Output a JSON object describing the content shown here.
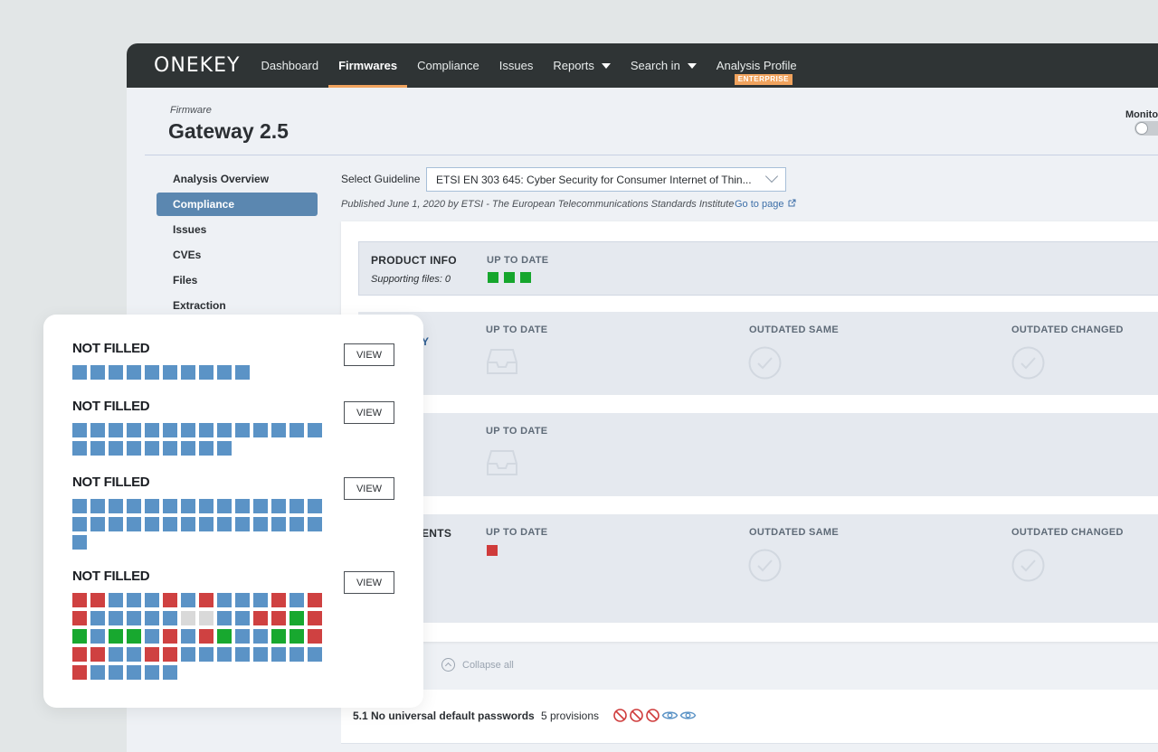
{
  "nav": {
    "logo": "ONEKEY",
    "items": [
      {
        "label": "Dashboard"
      },
      {
        "label": "Firmwares"
      },
      {
        "label": "Compliance"
      },
      {
        "label": "Issues"
      },
      {
        "label": "Reports"
      },
      {
        "label": "Search in"
      },
      {
        "label": "Analysis Profile"
      }
    ],
    "badge": "ENTERPRISE"
  },
  "header": {
    "label": "Firmware",
    "title": "Gateway 2.5",
    "monitor_label": "Monitor"
  },
  "sidebar": {
    "items": [
      {
        "label": "Analysis Overview"
      },
      {
        "label": "Compliance"
      },
      {
        "label": "Issues"
      },
      {
        "label": "CVEs"
      },
      {
        "label": "Files"
      },
      {
        "label": "Extraction"
      }
    ]
  },
  "guideline": {
    "label": "Select Guideline",
    "selected": "ETSI EN 303 645: Cyber Security for Consumer Internet of Thin...",
    "published": "Published June 1, 2020 by ETSI - The European Telecommunications Standards Institute",
    "goto_label": "Go to page"
  },
  "rows": {
    "product": {
      "title": "PRODUCT INFO",
      "sub": "Supporting files: 0",
      "col1": "UP TO DATE"
    },
    "row2": {
      "title_fragment": "Y",
      "col1": "UP TO DATE",
      "col2": "OUTDATED SAME",
      "col3": "OUTDATED CHANGED"
    },
    "row3": {
      "col1": "UP TO DATE"
    },
    "row4": {
      "title_fragment": "ENTS",
      "col1": "UP TO DATE",
      "col2": "OUTDATED SAME",
      "col3": "OUTDATED CHANGED"
    }
  },
  "collapse_label": "Collapse all",
  "section": {
    "title": "5.1 No universal default passwords",
    "provisions": "5 provisions",
    "icons": [
      "blocked-icon",
      "blocked-icon",
      "blocked-icon",
      "eye-icon",
      "eye-icon"
    ]
  },
  "card": {
    "groups": [
      {
        "status": "NOT FILLED",
        "button": "VIEW",
        "cells": "bbbbbbbbbb"
      },
      {
        "status": "NOT FILLED",
        "button": "VIEW",
        "cells": "bbbbbbbbbbbbbbbbbbbbbbb"
      },
      {
        "status": "NOT FILLED",
        "button": "VIEW",
        "cells": "bbbbbbbbbbbbbbbbbbbbbbbbbbbbb"
      },
      {
        "status": "NOT FILLED",
        "button": "VIEW",
        "cells": "rrbbbrbrbbbrbrrbbbbbxxbbrrgrgbggbrbrgbbggrrrbbrrbbbbbbbbrbbbbb"
      }
    ]
  },
  "colors": {
    "nav_bg": "#2f3435",
    "accent": "#f0a35e",
    "sidebar_active": "#5b87b0",
    "status_green": "#16a62d",
    "status_red": "#cf3b3b",
    "cell_blue": "#5b93c6",
    "cell_gray": "#d9d9d9"
  }
}
